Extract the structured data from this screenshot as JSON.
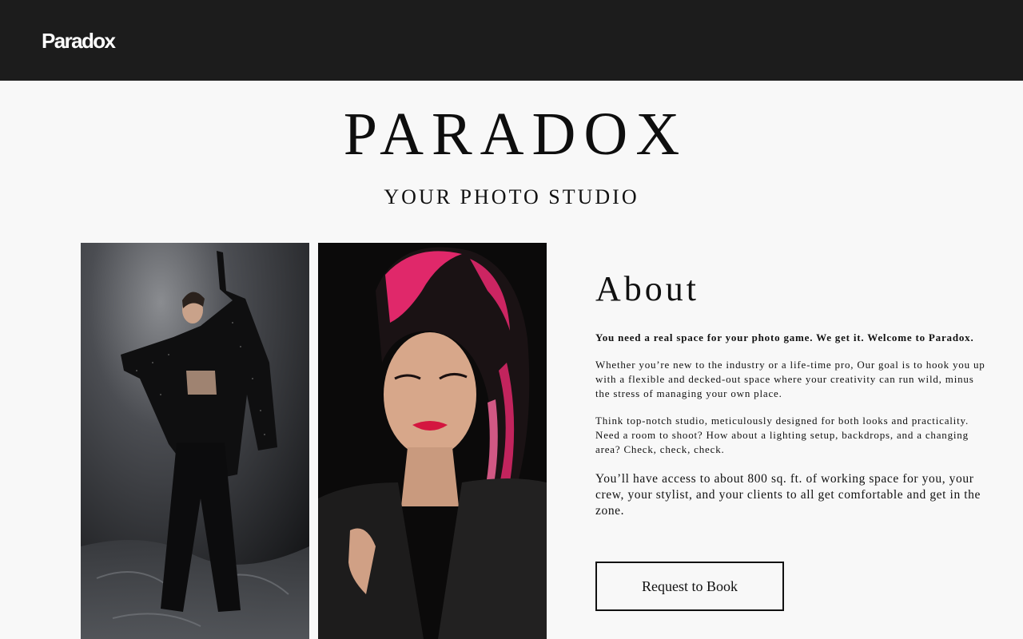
{
  "header": {
    "logo": "Paradox"
  },
  "hero": {
    "title": "PARADOX",
    "subtitle": "YOUR PHOTO STUDIO"
  },
  "about": {
    "heading": "About",
    "intro": "You need a real space for your photo game. We get it. Welcome to Paradox.",
    "paragraph_1": "Whether you’re new to the industry or a life-time pro, Our goal is to hook you up with a flexible and decked-out space where your creativity can run wild, minus the stress of managing your own place.",
    "paragraph_2": "Think top-notch studio, meticulously designed for both looks and practicality. Need a room to shoot? How about a lighting setup, backdrops, and a changing area? Check, check, check.",
    "paragraph_3": "You’ll have access to about 800 sq. ft. of working space for you, your crew, your stylist, and your clients to all get comfortable and get in the zone.",
    "cta_label": "Request to Book"
  },
  "colors": {
    "header_bg": "#1c1c1c",
    "page_bg": "#f8f8f8",
    "text": "#111111",
    "accent_pink": "#e0286a"
  }
}
